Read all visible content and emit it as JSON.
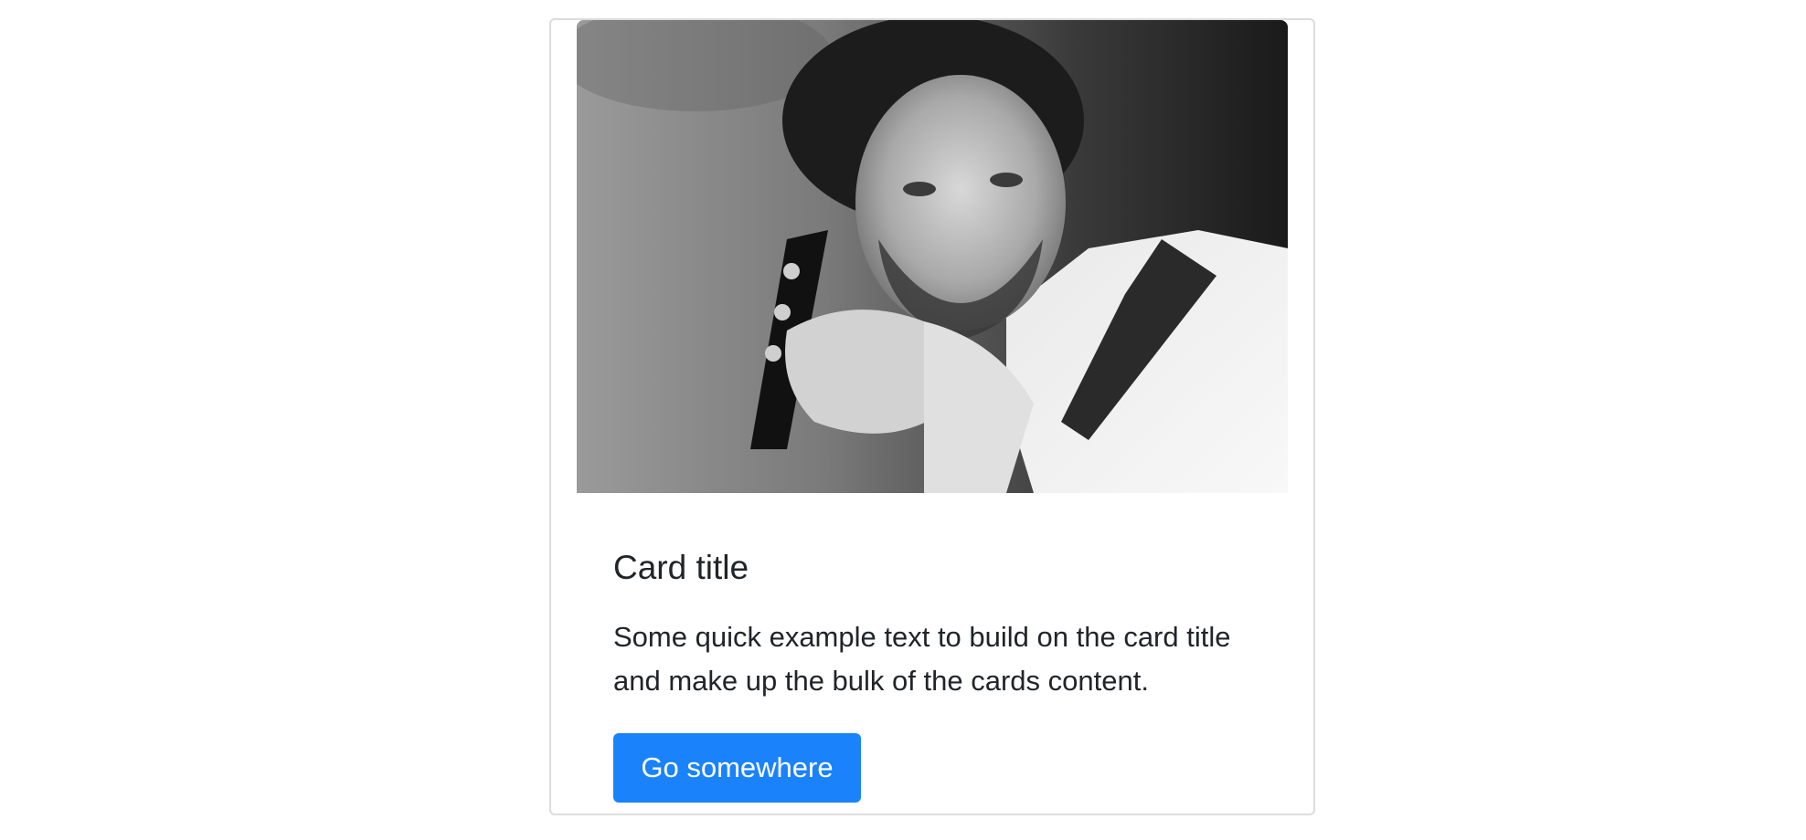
{
  "card": {
    "title": "Card title",
    "text": "Some quick example text to build on the card title and make up the bulk of the cards content.",
    "button_label": "Go somewhere"
  },
  "colors": {
    "button_bg": "#1a82fb",
    "text": "#212529",
    "border": "#dcdcdc"
  }
}
